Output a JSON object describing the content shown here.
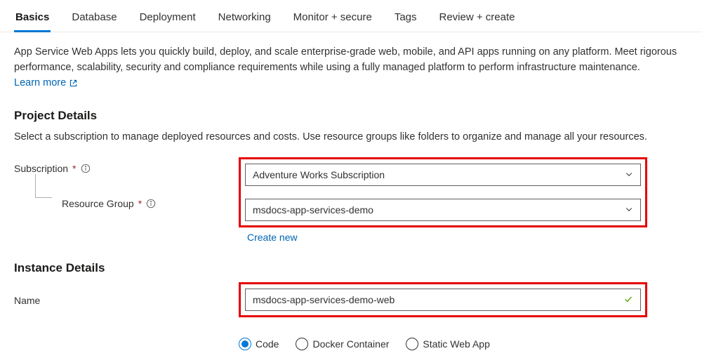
{
  "tabs": [
    {
      "label": "Basics",
      "active": true
    },
    {
      "label": "Database",
      "active": false
    },
    {
      "label": "Deployment",
      "active": false
    },
    {
      "label": "Networking",
      "active": false
    },
    {
      "label": "Monitor + secure",
      "active": false
    },
    {
      "label": "Tags",
      "active": false
    },
    {
      "label": "Review + create",
      "active": false
    }
  ],
  "intro": {
    "text": "App Service Web Apps lets you quickly build, deploy, and scale enterprise-grade web, mobile, and API apps running on any platform. Meet rigorous performance, scalability, security and compliance requirements while using a fully managed platform to perform infrastructure maintenance.  ",
    "learn_more": "Learn more"
  },
  "project_details": {
    "title": "Project Details",
    "desc": "Select a subscription to manage deployed resources and costs. Use resource groups like folders to organize and manage all your resources.",
    "subscription_label": "Subscription",
    "subscription_value": "Adventure Works Subscription",
    "resource_group_label": "Resource Group",
    "resource_group_value": "msdocs-app-services-demo",
    "create_new": "Create new"
  },
  "instance_details": {
    "title": "Instance Details",
    "name_label": "Name",
    "name_value": "msdocs-app-services-demo-web"
  },
  "publish": {
    "options": [
      "Code",
      "Docker Container",
      "Static Web App"
    ],
    "selected_index": 0
  }
}
